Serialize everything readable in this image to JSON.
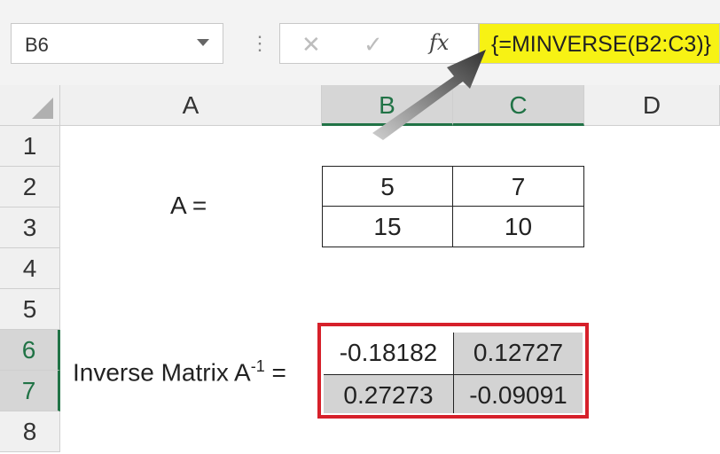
{
  "namebox": {
    "value": "B6"
  },
  "toolbar": {
    "cancel_icon": "✕",
    "enter_icon": "✓",
    "fx_label": "fx",
    "dots": "⋮"
  },
  "formula": {
    "value": "{=MINVERSE(B2:C3)}",
    "highlight_color": "#f7f214"
  },
  "columns": [
    "A",
    "B",
    "C",
    "D"
  ],
  "rows": [
    "1",
    "2",
    "3",
    "4",
    "5",
    "6",
    "7",
    "8"
  ],
  "matrix_label": "A =",
  "matrix": [
    [
      "5",
      "7"
    ],
    [
      "15",
      "10"
    ]
  ],
  "inverse_label": "Inverse Matrix A",
  "inverse_sup": "-1",
  "inverse_eq": " =",
  "inverse": [
    [
      "-0.18182",
      "0.12727"
    ],
    [
      "0.27273",
      "-0.09091"
    ]
  ],
  "colors": {
    "selection_green": "#217346",
    "result_border": "#d6202a"
  }
}
